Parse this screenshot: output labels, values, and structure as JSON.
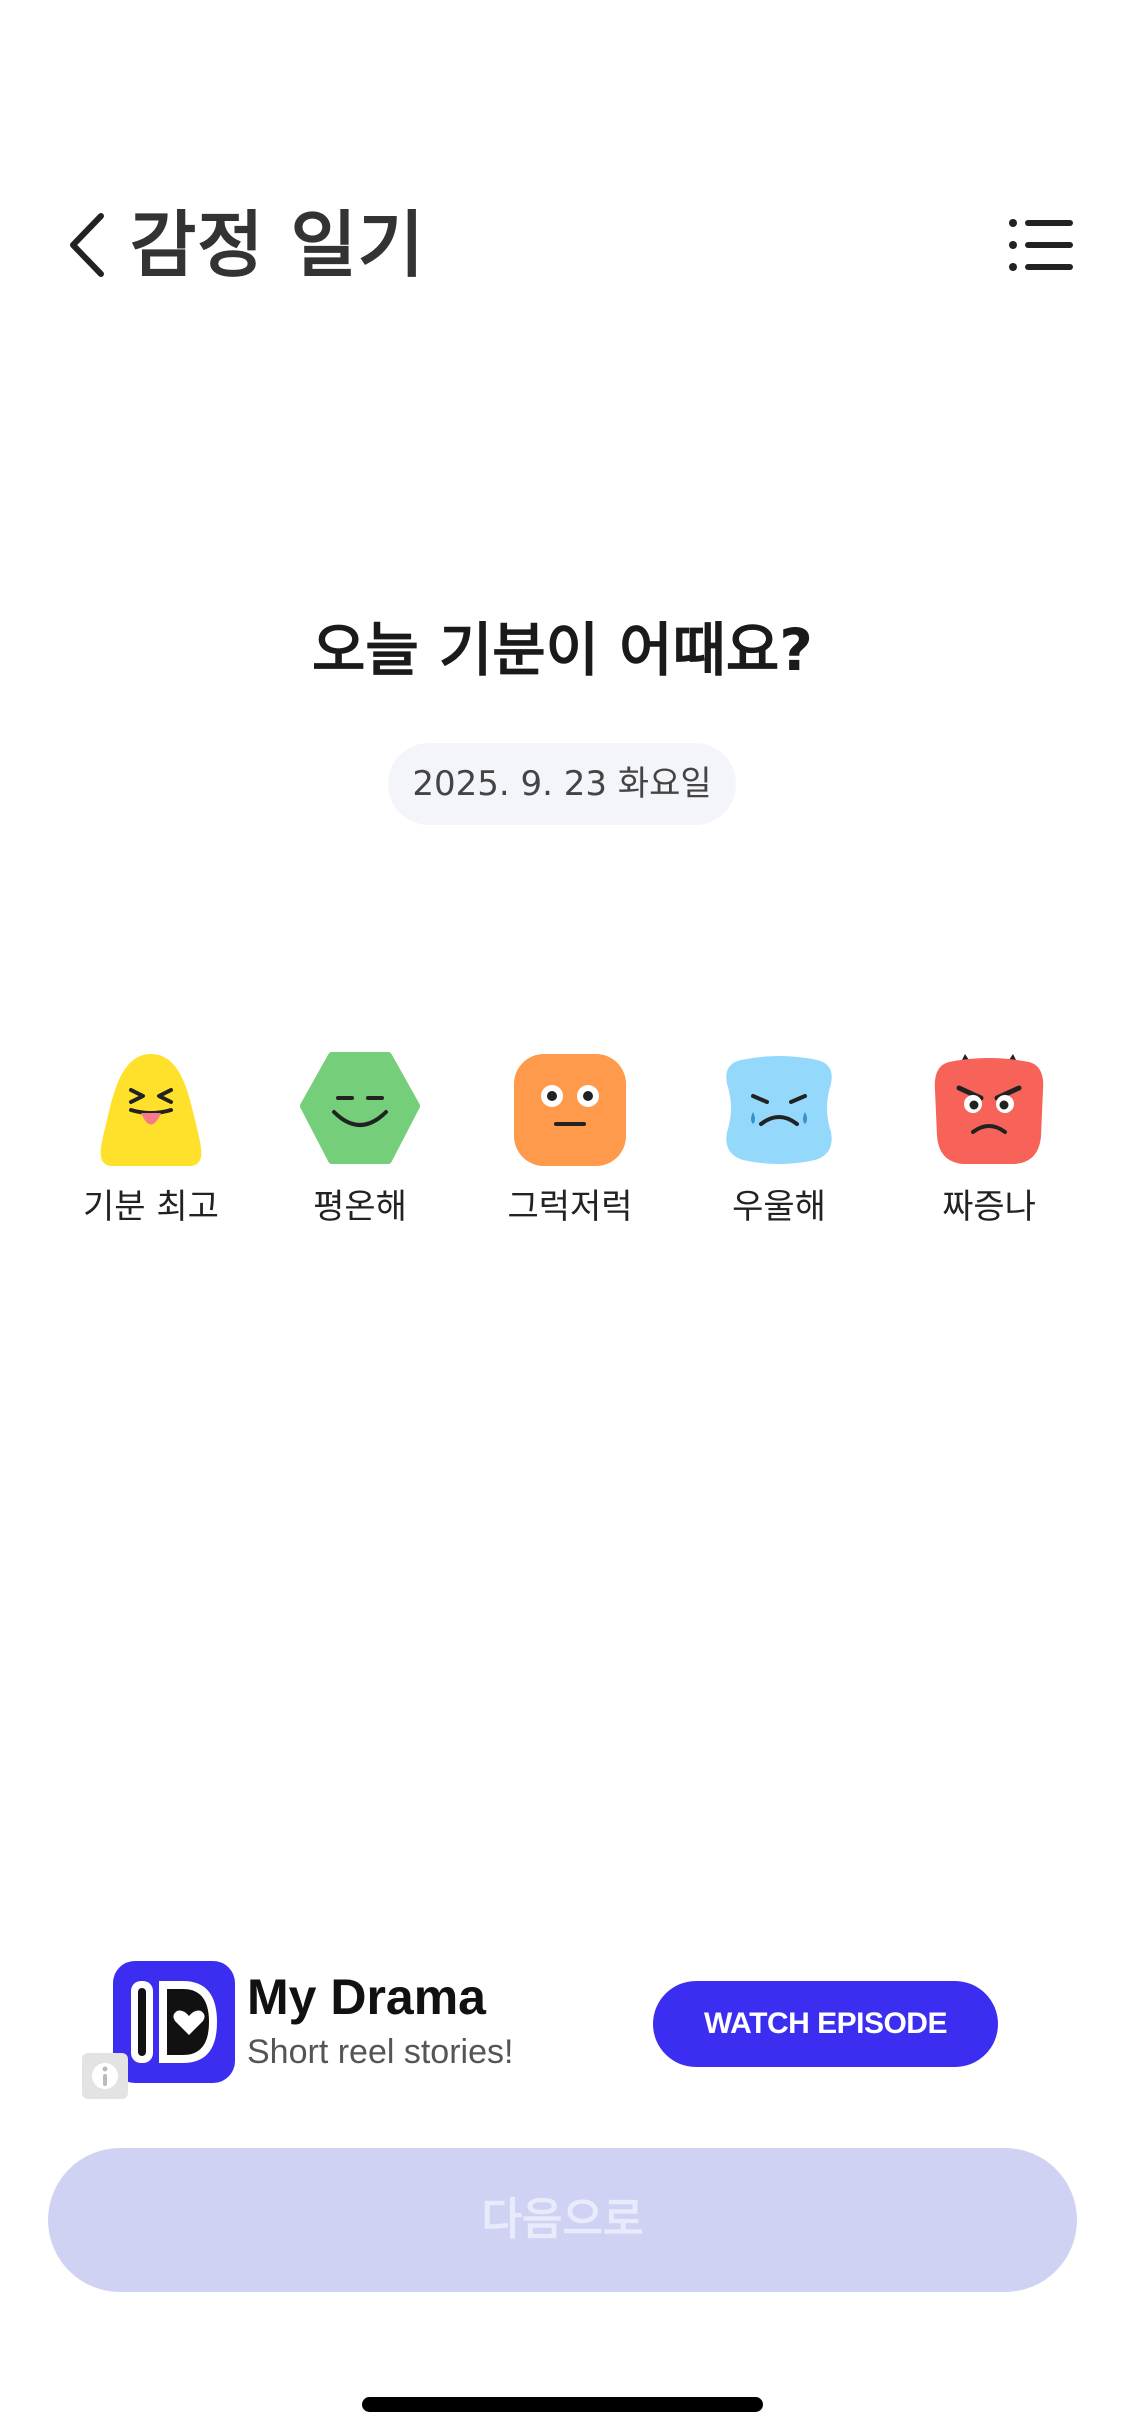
{
  "header": {
    "title": "감정 일기",
    "back_icon": "chevron-left-icon",
    "menu_icon": "list-icon"
  },
  "question": "오늘 기분이 어때요?",
  "date": "2025. 9. 23 화요일",
  "moods": [
    {
      "label": "기분 최고",
      "icon": "laughing-face-icon",
      "color": "#FFE02A"
    },
    {
      "label": "평온해",
      "icon": "calm-face-icon",
      "color": "#74CE7A"
    },
    {
      "label": "그럭저럭",
      "icon": "neutral-face-icon",
      "color": "#FF9A4C"
    },
    {
      "label": "우울해",
      "icon": "sad-face-icon",
      "color": "#94D8FB"
    },
    {
      "label": "짜증나",
      "icon": "angry-face-icon",
      "color": "#F76358"
    }
  ],
  "ad": {
    "title": "My Drama",
    "subtitle": "Short reel stories!",
    "cta": "WATCH EPISODE",
    "accent": "#3B2EF0"
  },
  "next_button": "다음으로",
  "colors": {
    "next_button_bg": "#CFD2F2",
    "date_pill_bg": "#F4F5FB"
  }
}
